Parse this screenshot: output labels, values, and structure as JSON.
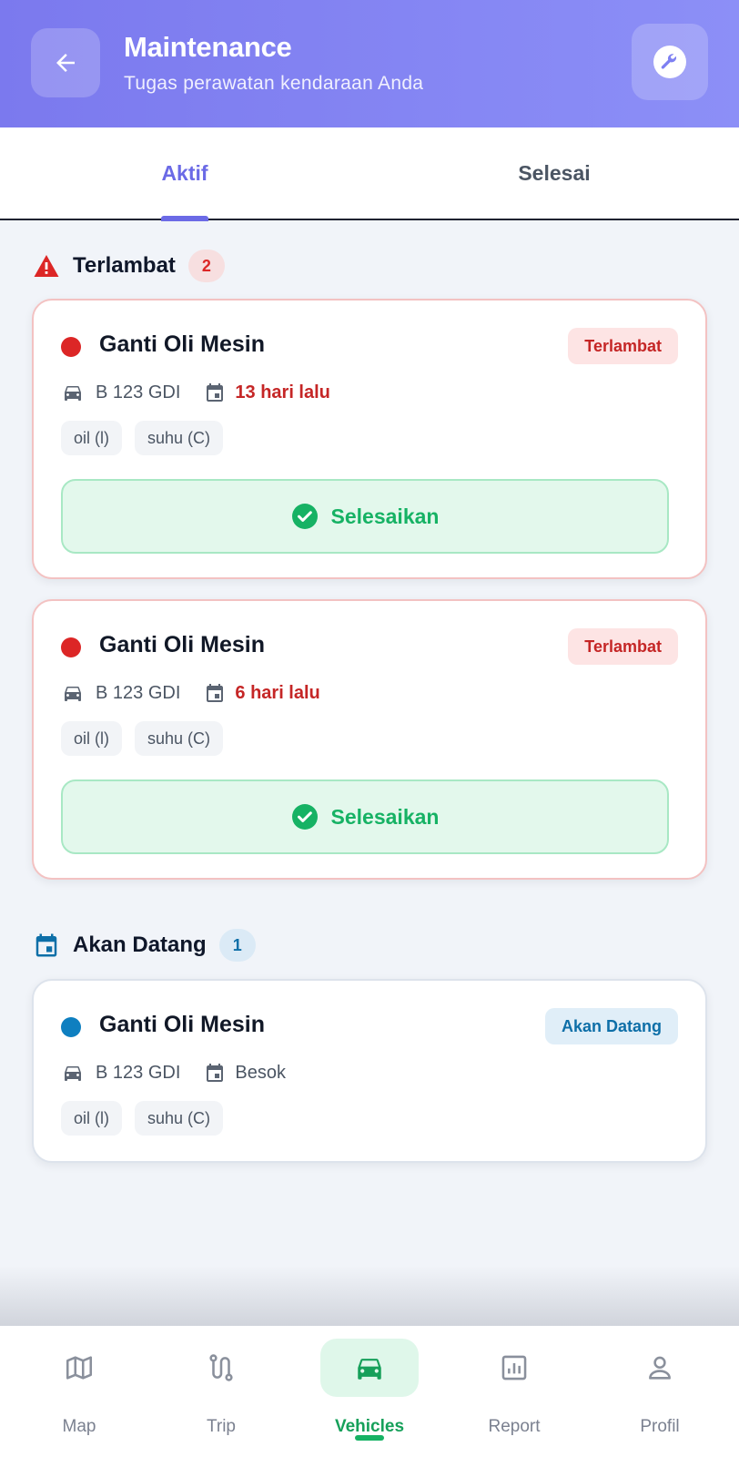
{
  "header": {
    "title": "Maintenance",
    "subtitle": "Tugas perawatan kendaraan Anda",
    "back_icon": "arrow-left-icon",
    "action_icon": "wrench-icon"
  },
  "tabs": [
    {
      "label": "Aktif",
      "active": true
    },
    {
      "label": "Selesai",
      "active": false
    }
  ],
  "sections": {
    "overdue": {
      "title": "Terlambat",
      "count": "2",
      "icon": "warning-icon",
      "cards": [
        {
          "title": "Ganti Oli Mesin",
          "status": "Terlambat",
          "plate": "B 123 GDI",
          "due": "13 hari lalu",
          "tags": [
            "oil (l)",
            "suhu (C)"
          ],
          "action": "Selesaikan"
        },
        {
          "title": "Ganti Oli Mesin",
          "status": "Terlambat",
          "plate": "B 123 GDI",
          "due": "6 hari lalu",
          "tags": [
            "oil (l)",
            "suhu (C)"
          ],
          "action": "Selesaikan"
        }
      ]
    },
    "upcoming": {
      "title": "Akan Datang",
      "count": "1",
      "icon": "calendar-icon",
      "cards": [
        {
          "title": "Ganti Oli Mesin",
          "status": "Akan Datang",
          "plate": "B 123 GDI",
          "due": "Besok",
          "tags": [
            "oil (l)",
            "suhu (C)"
          ]
        }
      ]
    }
  },
  "nav": [
    {
      "label": "Map",
      "icon": "map-icon",
      "active": false
    },
    {
      "label": "Trip",
      "icon": "route-icon",
      "active": false
    },
    {
      "label": "Vehicles",
      "icon": "car-icon",
      "active": true
    },
    {
      "label": "Report",
      "icon": "bar-chart-icon",
      "active": false
    },
    {
      "label": "Profil",
      "icon": "person-icon",
      "active": false
    }
  ],
  "colors": {
    "header": "#7b79ee",
    "accent": "#6b6ae6",
    "overdue": "#dc2626",
    "upcoming": "#0e7fc0",
    "success": "#16b264"
  }
}
